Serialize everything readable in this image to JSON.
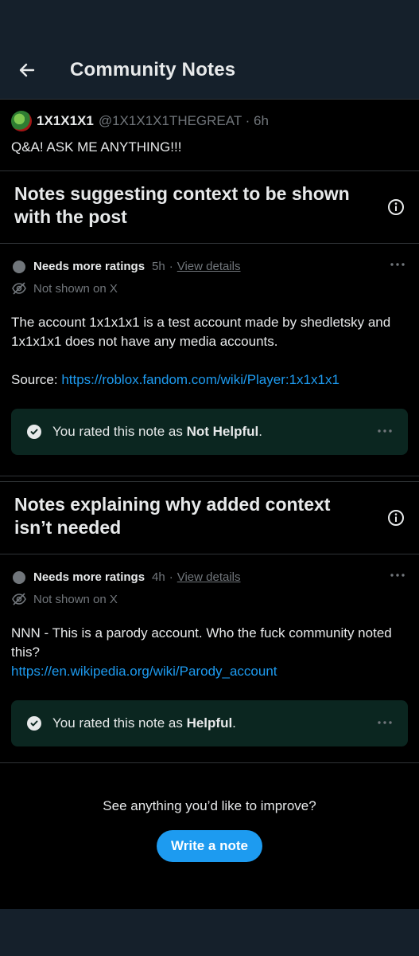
{
  "header": {
    "title": "Community Notes"
  },
  "post": {
    "name": "1X1X1X1",
    "handle": "@1X1X1X1THEGREAT · 6h",
    "text": "Q&A! ASK ME ANYTHING!!!"
  },
  "sections": [
    {
      "title": "Notes suggesting context to be shown with the post",
      "note": {
        "status": "Needs more ratings",
        "time": "5h",
        "view_details": "View details",
        "not_shown": "Not shown on X",
        "body_line1": "The account 1x1x1x1 is a test account made by shedletsky and 1x1x1x1 does not have any media accounts.",
        "source_label": "Source:",
        "source_link": "https://roblox.fandom.com/wiki/Player:1x1x1x1",
        "rated_prefix": "You rated this note as",
        "rating": "Not Helpful"
      }
    },
    {
      "title": "Notes explaining why added context isn’t needed",
      "note": {
        "status": "Needs more ratings",
        "time": "4h",
        "view_details": "View details",
        "not_shown": "Not shown on X",
        "body_line1": "NNN - This is a parody account. Who the fuck community noted this?",
        "link": "https://en.wikipedia.org/wiki/Parody_account",
        "rated_prefix": "You rated this note as",
        "rating": "Helpful"
      }
    }
  ],
  "footer": {
    "prompt": "See anything you’d like to improve?",
    "button": "Write a note"
  },
  "icons": {
    "back": "arrow-left-icon",
    "info": "info-circle-icon",
    "more": "more-dots-icon",
    "eye_off": "eye-slash-icon",
    "check": "check-circle-icon"
  },
  "colors": {
    "background": "#000000",
    "header": "#15202b",
    "accent": "#1d9bf0",
    "rated_box": "#0b2620",
    "muted": "#71767b"
  }
}
